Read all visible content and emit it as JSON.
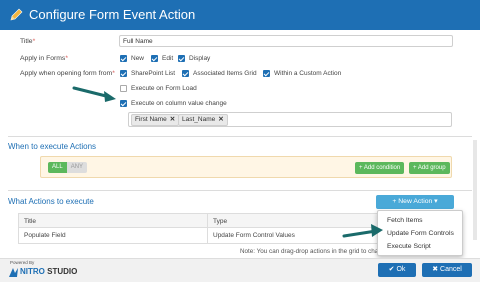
{
  "dialog": {
    "title": "Configure Form Event Action"
  },
  "form": {
    "title_label": "Title",
    "title_value": "Full Name",
    "apply_in_forms_label": "Apply in Forms",
    "forms": [
      {
        "label": "New",
        "checked": true
      },
      {
        "label": "Edit",
        "checked": true
      },
      {
        "label": "Display",
        "checked": true
      }
    ],
    "apply_when_label": "Apply when opening form from",
    "sources": [
      {
        "label": "SharePoint List",
        "checked": true
      },
      {
        "label": "Associated Items Grid",
        "checked": true
      },
      {
        "label": "Within a Custom Action",
        "checked": true
      }
    ],
    "execute_on_load": {
      "label": "Execute on Form Load",
      "checked": false
    },
    "execute_on_change": {
      "label": "Execute on column value change",
      "checked": true
    },
    "columns": [
      "First Name",
      "Last_Name"
    ]
  },
  "when_section": {
    "heading": "When to execute Actions",
    "all_label": "ALL",
    "any_label": "ANY",
    "add_condition": "Add condition",
    "add_group": "Add group"
  },
  "actions_section": {
    "heading": "What Actions to execute",
    "new_action_label": "New Action",
    "columns": [
      "Title",
      "Type"
    ],
    "rows": [
      {
        "title": "Populate Field",
        "type": "Update Form Control Values"
      }
    ],
    "note": "Note: You can drag-drop actions in the grid to change order of execution."
  },
  "dropdown": {
    "items": [
      "Fetch Items",
      "Update Form Controls",
      "Execute Script"
    ]
  },
  "footer": {
    "powered_by": "Powered By",
    "brand_a": "NITRO",
    "brand_b": "STUDIO",
    "ok_label": "Ok",
    "cancel_label": "Cancel"
  },
  "colors": {
    "header_blue": "#1e6fb4",
    "accent_green": "#5cb85c",
    "new_action_blue": "#4aa9d8",
    "annotation_arrow": "#1a6a6a"
  }
}
